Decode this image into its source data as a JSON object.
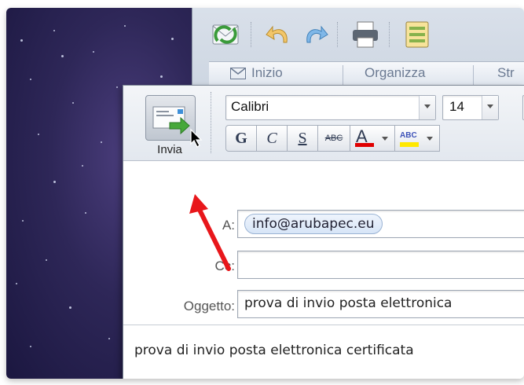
{
  "window": {
    "tabs": [
      {
        "label": "Inizio"
      },
      {
        "label": "Organizza"
      },
      {
        "label": "Str"
      }
    ]
  },
  "compose": {
    "send_label": "Invia",
    "font": {
      "name": "Calibri",
      "size": "14"
    },
    "format_buttons": {
      "bold": "G",
      "italic": "C",
      "underline": "S",
      "strikethrough": "ABC",
      "font_color": "A",
      "highlight": "ABC"
    },
    "colors": {
      "font_color": "#e00000",
      "highlight": "#ffe800",
      "arrow": "#e8171b"
    },
    "fields": {
      "to_label": "A:",
      "to_recipient": "info@arubapec.eu",
      "cc_label": "Cc:",
      "cc_value": "",
      "subject_label": "Oggetto:",
      "subject_value": "prova di invio posta elettronica"
    },
    "body": "prova di invio posta elettronica certificata"
  }
}
